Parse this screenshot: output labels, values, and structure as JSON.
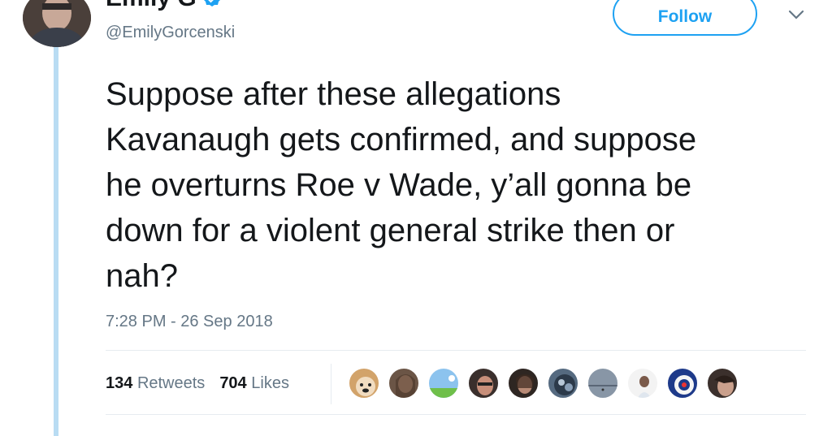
{
  "author": {
    "display_name": "Emily G",
    "handle": "@EmilyGorcenski",
    "verified": true
  },
  "follow_button": {
    "label": "Follow"
  },
  "tweet": {
    "lines": [
      "Suppose after these allegations",
      "Kavanaugh gets confirmed, and suppose",
      "he overturns Roe v Wade, y’all gonna be",
      "down for a violent general strike then or",
      "nah?"
    ],
    "timestamp": "7:28 PM - 26 Sep 2018"
  },
  "stats": {
    "retweets_count": "134",
    "retweets_label": "Retweets",
    "likes_count": "704",
    "likes_label": "Likes"
  },
  "icons": {
    "verified": "verified-badge-icon",
    "caret": "chevron-down-icon"
  },
  "colors": {
    "brand_blue": "#1da1f2",
    "thread_line": "#b9dcf3",
    "secondary_text": "#657786"
  }
}
